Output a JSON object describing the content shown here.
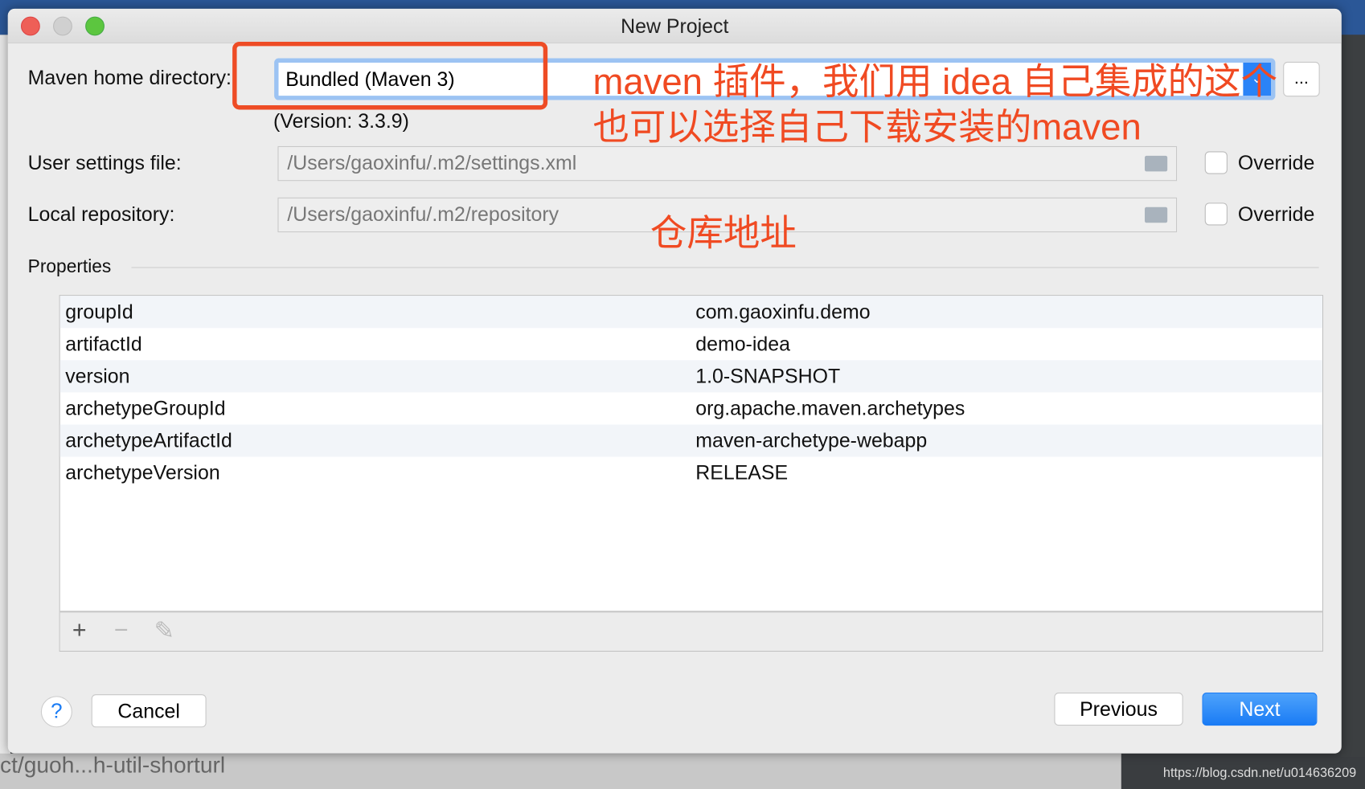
{
  "window": {
    "title": "New Project"
  },
  "maven": {
    "home_label": "Maven home directory:",
    "home_value": "Bundled (Maven 3)",
    "version": "(Version: 3.3.9)",
    "browse_label": "...",
    "settings_label": "User settings file:",
    "settings_value": "/Users/gaoxinfu/.m2/settings.xml",
    "repo_label": "Local repository:",
    "repo_value": "/Users/gaoxinfu/.m2/repository",
    "override_label": "Override",
    "override_settings": false,
    "override_repo": false
  },
  "annotations": {
    "line1": "maven 插件，我们用 idea 自己集成的这个",
    "line2": "也可以选择自己下载安装的maven",
    "repo": "仓库地址",
    "color": "#f04a22"
  },
  "properties": {
    "label": "Properties",
    "rows": [
      {
        "key": "groupId",
        "value": "com.gaoxinfu.demo"
      },
      {
        "key": "artifactId",
        "value": "demo-idea"
      },
      {
        "key": "version",
        "value": "1.0-SNAPSHOT"
      },
      {
        "key": "archetypeGroupId",
        "value": "org.apache.maven.archetypes"
      },
      {
        "key": "archetypeArtifactId",
        "value": "maven-archetype-webapp"
      },
      {
        "key": "archetypeVersion",
        "value": "RELEASE"
      }
    ],
    "toolbar": {
      "add": "+",
      "remove": "−",
      "edit": "✎"
    }
  },
  "buttons": {
    "help": "?",
    "cancel": "Cancel",
    "previous": "Previous",
    "next": "Next",
    "next_color": "#1a7cf5"
  },
  "background": {
    "bottom_text": "ct/guoh...h-util-shorturl",
    "watermark": "https://blog.csdn.net/u014636209"
  }
}
